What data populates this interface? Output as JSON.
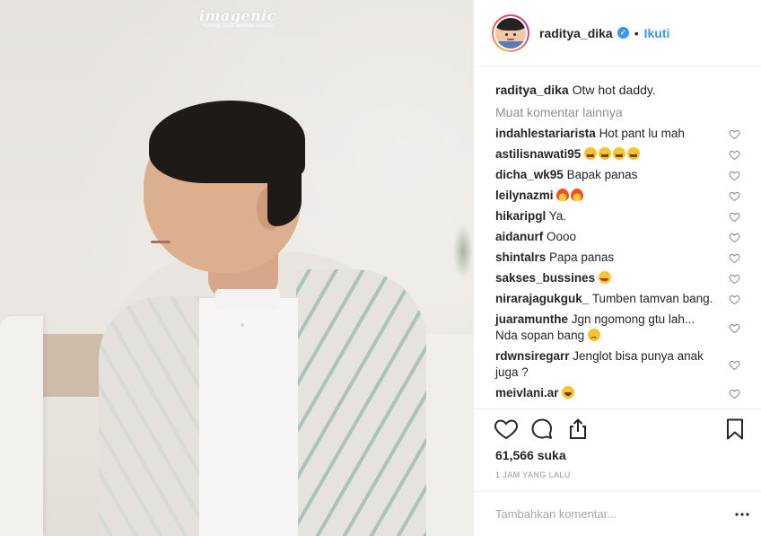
{
  "photo": {
    "watermark_title": "imagenic",
    "watermark_tagline": "•telling story without words•"
  },
  "header": {
    "username": "raditya_dika",
    "verified_icon": "verified-badge-icon",
    "separator": "•",
    "follow_label": "Ikuti"
  },
  "caption": {
    "username": "raditya_dika",
    "text": "Otw hot daddy."
  },
  "load_more": "Muat komentar lainnya",
  "comments": [
    {
      "username": "indahlestariarista",
      "text": "Hot pant lu mah"
    },
    {
      "username": "astilisnawati95",
      "text": ""
    },
    {
      "username": "dicha_wk95",
      "text": "Bapak panas"
    },
    {
      "username": "leilynazmi",
      "text": ""
    },
    {
      "username": "hikaripgl",
      "text": "Ya."
    },
    {
      "username": "aidanurf",
      "text": "Oooo"
    },
    {
      "username": "shintalrs",
      "text": "Papa panas"
    },
    {
      "username": "sakses_bussines",
      "text": ""
    },
    {
      "username": "nirarajagukguk_",
      "text": "Tumben tamvan bang."
    },
    {
      "username": "juaramunthe",
      "text": "Jgn ngomong gtu lah... Nda sopan bang"
    },
    {
      "username": "rdwnsiregarr",
      "text": "Jenglot bisa punya anak juga ?"
    },
    {
      "username": "meivlani.ar",
      "text": ""
    }
  ],
  "actions": {
    "like_icon": "heart-icon",
    "comment_icon": "comment-icon",
    "share_icon": "share-icon",
    "save_icon": "bookmark-icon"
  },
  "likes": "61,566 suka",
  "timestamp": "1 JAM YANG LALU",
  "add_comment": {
    "placeholder": "Tambahkan komentar..."
  },
  "colors": {
    "link_blue": "#3897f0",
    "text": "#262626",
    "muted": "#8e8e8e",
    "border": "#efefef"
  }
}
